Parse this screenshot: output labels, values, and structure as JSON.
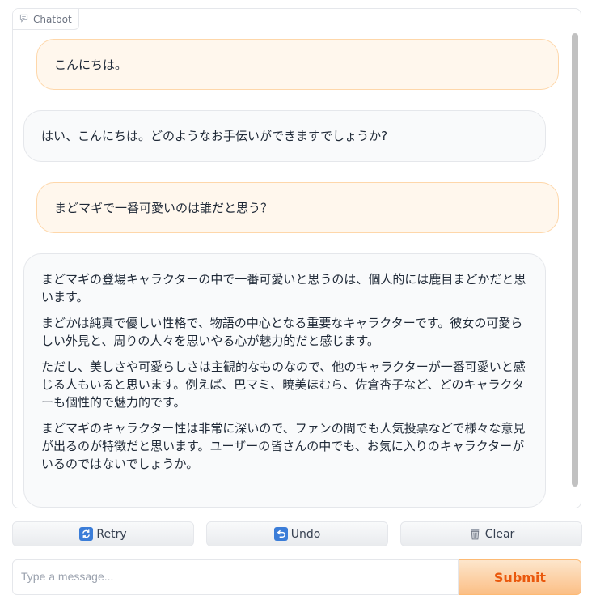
{
  "chatbot": {
    "label": "Chatbot",
    "messages": [
      {
        "role": "user",
        "text": "こんにちは。"
      },
      {
        "role": "bot",
        "text": "はい、こんにちは。どのようなお手伝いができますでしょうか?"
      },
      {
        "role": "user",
        "text": "まどマギで一番可愛いのは誰だと思う？"
      },
      {
        "role": "bot",
        "paragraphs": [
          "まどマギの登場キャラクターの中で一番可愛いと思うのは、個人的には鹿目まどかだと思います。",
          "まどかは純真で優しい性格で、物語の中心となる重要なキャラクターです。彼女の可愛らしい外見と、周りの人々を思いやる心が魅力的だと感じます。",
          "ただし、美しさや可愛らしさは主観的なものなので、他のキャラクターが一番可愛いと感じる人もいると思います。例えば、巴マミ、暁美ほむら、佐倉杏子など、どのキャラクターも個性的で魅力的です。",
          "まどマギのキャラクター性は非常に深いので、ファンの間でも人気投票などで様々な意見が出るのが特徴だと思います。ユーザーの皆さんの中でも、お気に入りのキャラクターがいるのではないでしょうか。"
        ]
      }
    ]
  },
  "buttons": {
    "retry": "Retry",
    "undo": "Undo",
    "clear": "Clear"
  },
  "input": {
    "placeholder": "Type a message...",
    "value": ""
  },
  "submit": "Submit",
  "icons": {
    "chatbot": "chat-bubble-icon",
    "retry": "retry-arrows-icon",
    "undo": "undo-arrow-icon",
    "clear": "trash-can-icon"
  },
  "colors": {
    "user_bubble": "#fff7ed",
    "user_border": "#fed7aa",
    "bot_bubble": "#f9fafb",
    "accent": "#ea580c"
  }
}
